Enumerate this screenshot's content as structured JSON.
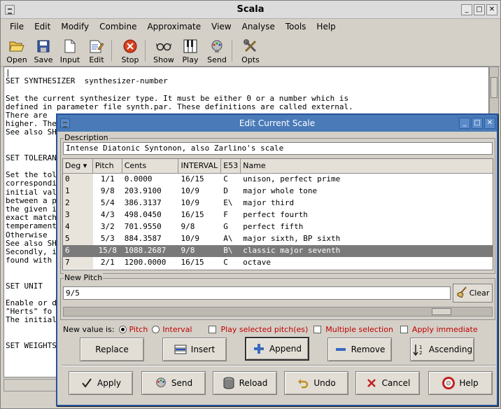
{
  "main_window": {
    "title": "Scala",
    "menu": [
      "File",
      "Edit",
      "Modify",
      "Combine",
      "Approximate",
      "View",
      "Analyse",
      "Tools",
      "Help"
    ],
    "toolbar": {
      "open": "Open",
      "save": "Save",
      "input": "Input",
      "edit": "Edit",
      "stop": "Stop",
      "show": "Show",
      "play": "Play",
      "send": "Send",
      "opts": "Opts"
    },
    "text_lines": [
      "|",
      "SET SYNTHESIZER  synthesizer-number",
      "",
      "Set the current synthesizer type. It must be either 0 or a number which is",
      "defined in parameter file synth.par. These definitions are called external.",
      "There are",
      "higher. The",
      "See also SH",
      "",
      "",
      "SET TOLERAN",
      "",
      "Set the tol",
      "correspondi",
      "initial val",
      "between a p",
      "the given i",
      "exact match",
      "temperament",
      "Otherwise",
      "See also SH",
      "Secondly, i",
      "found with",
      "",
      "",
      "SET UNIT",
      "",
      "Enable or d",
      "\"Herts\" fo",
      "The initial",
      "",
      "",
      "SET WEIGHTS"
    ]
  },
  "dialog": {
    "title": "Edit Current Scale",
    "description_label": "Description",
    "description_value": "Intense Diatonic Syntonon, also Zarlino's scale",
    "columns": [
      "Deg",
      "Pitch",
      "Cents",
      "INTERVAL",
      "E53",
      "Name"
    ],
    "rows": [
      {
        "deg": "0",
        "pitch": "1/1",
        "cents": "0.0000",
        "interval": "16/15",
        "e53": "C",
        "name": "unison, perfect prime"
      },
      {
        "deg": "1",
        "pitch": "9/8",
        "cents": "203.9100",
        "interval": "10/9",
        "e53": "D",
        "name": "major whole tone"
      },
      {
        "deg": "2",
        "pitch": "5/4",
        "cents": "386.3137",
        "interval": "10/9",
        "e53": "E\\",
        "name": "major third"
      },
      {
        "deg": "3",
        "pitch": "4/3",
        "cents": "498.0450",
        "interval": "16/15",
        "e53": "F",
        "name": "perfect fourth"
      },
      {
        "deg": "4",
        "pitch": "3/2",
        "cents": "701.9550",
        "interval": "9/8",
        "e53": "G",
        "name": "perfect fifth"
      },
      {
        "deg": "5",
        "pitch": "5/3",
        "cents": "884.3587",
        "interval": "10/9",
        "e53": "A\\",
        "name": "major sixth, BP sixth"
      },
      {
        "deg": "6",
        "pitch": "15/8",
        "cents": "1088.2687",
        "interval": "9/8",
        "e53": "B\\",
        "name": "classic major seventh"
      },
      {
        "deg": "7",
        "pitch": "2/1",
        "cents": "1200.0000",
        "interval": "16/15",
        "e53": "C",
        "name": "octave"
      }
    ],
    "selected_row": 6,
    "new_pitch_label": "New Pitch",
    "new_pitch_value": "9/5",
    "clear_label": "Clear",
    "new_value_is": "New value is:",
    "opt_pitch": "Pitch",
    "opt_interval": "Interval",
    "chk_play": "Play selected pitch(es)",
    "chk_multiple": "Multiple selection",
    "chk_apply": "Apply immediate",
    "buttons": {
      "replace": "Replace",
      "insert": "Insert",
      "append": "Append",
      "remove": "Remove",
      "ascending": "Ascending",
      "apply": "Apply",
      "send": "Send",
      "reload": "Reload",
      "undo": "Undo",
      "cancel": "Cancel",
      "help": "Help"
    },
    "colors": {
      "title_bg": "#4a7ab8",
      "selected_row_bg": "#7a7a7a",
      "red_text": "#c00000"
    }
  }
}
